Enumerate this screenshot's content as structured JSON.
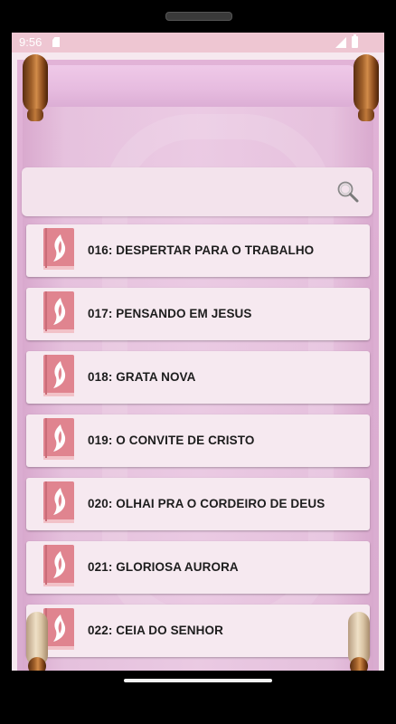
{
  "status_bar": {
    "time": "9:56"
  },
  "search": {
    "placeholder": ""
  },
  "hymns": [
    {
      "label": "016: DESPERTAR PARA O TRABALHO"
    },
    {
      "label": "017: PENSANDO EM JESUS"
    },
    {
      "label": "018: GRATA NOVA"
    },
    {
      "label": "019: O CONVITE DE CRISTO"
    },
    {
      "label": "020: OLHAI PRA O CORDEIRO DE DEUS"
    },
    {
      "label": "021: GLORIOSA AURORA"
    },
    {
      "label": "022: CEIA DO SENHOR"
    }
  ],
  "icons": {
    "list_item": "book-flame-icon",
    "search": "search-icon"
  },
  "colors": {
    "status_bar": "#eec6d2",
    "scroll_background": "#e2b3d7",
    "list_item_background": "#f6e9f0",
    "book_icon": "#e0848f"
  }
}
